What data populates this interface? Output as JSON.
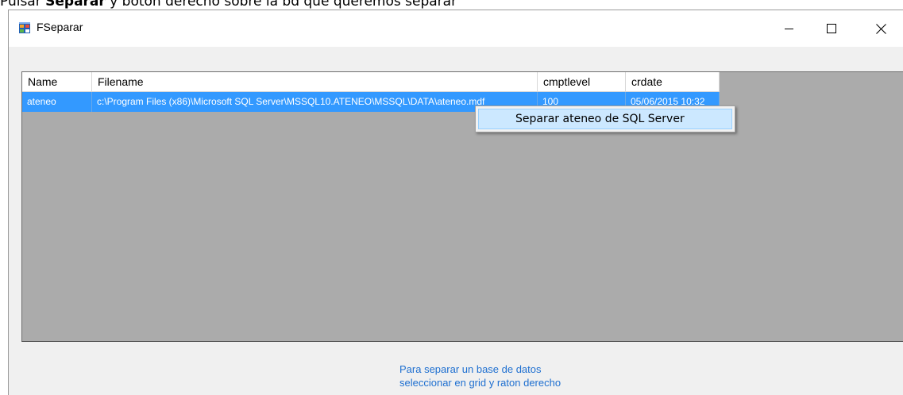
{
  "doc_caption": {
    "prefix": "Pulsar ",
    "bold": "Separar",
    "suffix": " y botón derecho sobre la bd que queremos separar"
  },
  "window": {
    "title": "FSeparar",
    "app_icon": "form-app-icon",
    "buttons": {
      "minimize": "minimize-icon",
      "maximize": "maximize-icon",
      "close": "close-icon"
    }
  },
  "grid": {
    "columns": [
      "Name",
      "Filename",
      "cmptlevel",
      "crdate"
    ],
    "rows": [
      {
        "name": "ateneo",
        "filename": "c:\\Program Files (x86)\\Microsoft SQL Server\\MSSQL10.ATENEO\\MSSQL\\DATA\\ateneo.mdf",
        "cmptlevel": "100",
        "crdate": "05/06/2015 10:32"
      }
    ],
    "selected_row": 0,
    "colors": {
      "background": "#ababab",
      "selection": "#3399ff",
      "header": "#ffffff"
    }
  },
  "context_menu": {
    "items": [
      "Separar ateneo de SQL Server"
    ]
  },
  "hint": {
    "line1": "Para separar un base de datos",
    "line2": "seleccionar en grid y raton derecho",
    "color": "#1e6fd0"
  }
}
